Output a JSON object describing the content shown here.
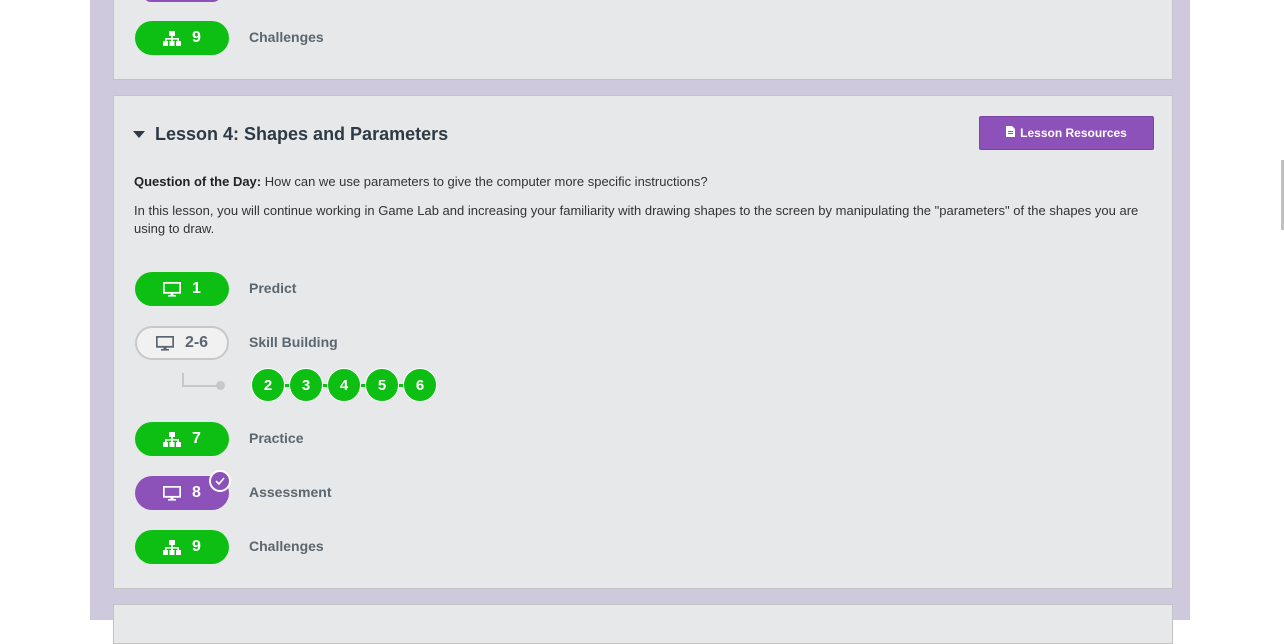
{
  "previous_lesson": {
    "level": {
      "icon": "flowchart-icon",
      "number": "9",
      "name": "Challenges",
      "color": "#0dbf12"
    }
  },
  "lesson": {
    "title": "Lesson 4: Shapes and Parameters",
    "resources_button": "Lesson Resources",
    "question_label": "Question of the Day:",
    "question_text": " How can we use parameters to give the computer more specific instructions?",
    "description": "In this lesson, you will continue working in Game Lab and increasing your familiarity with drawing shapes to the screen by manipulating the \"parameters\" of the shapes you are using to draw.",
    "levels": [
      {
        "icon": "monitor-icon",
        "number": "1",
        "name": "Predict",
        "status": "completed",
        "color": "#0dbf12"
      },
      {
        "icon": "monitor-icon",
        "number": "2-6",
        "name": "Skill Building",
        "status": "group",
        "color": "#c8c8c8",
        "sublevels": [
          "2",
          "3",
          "4",
          "5",
          "6"
        ]
      },
      {
        "icon": "flowchart-icon",
        "number": "7",
        "name": "Practice",
        "status": "completed",
        "color": "#0dbf12"
      },
      {
        "icon": "monitor-icon",
        "number": "8",
        "name": "Assessment",
        "status": "submitted",
        "color": "#8c52ba"
      },
      {
        "icon": "flowchart-icon",
        "number": "9",
        "name": "Challenges",
        "status": "completed",
        "color": "#0dbf12"
      }
    ]
  },
  "colors": {
    "completed": "#0dbf12",
    "assessment": "#8c52ba",
    "page_background": "#cfc9de",
    "card_background": "#e7e8ea"
  }
}
